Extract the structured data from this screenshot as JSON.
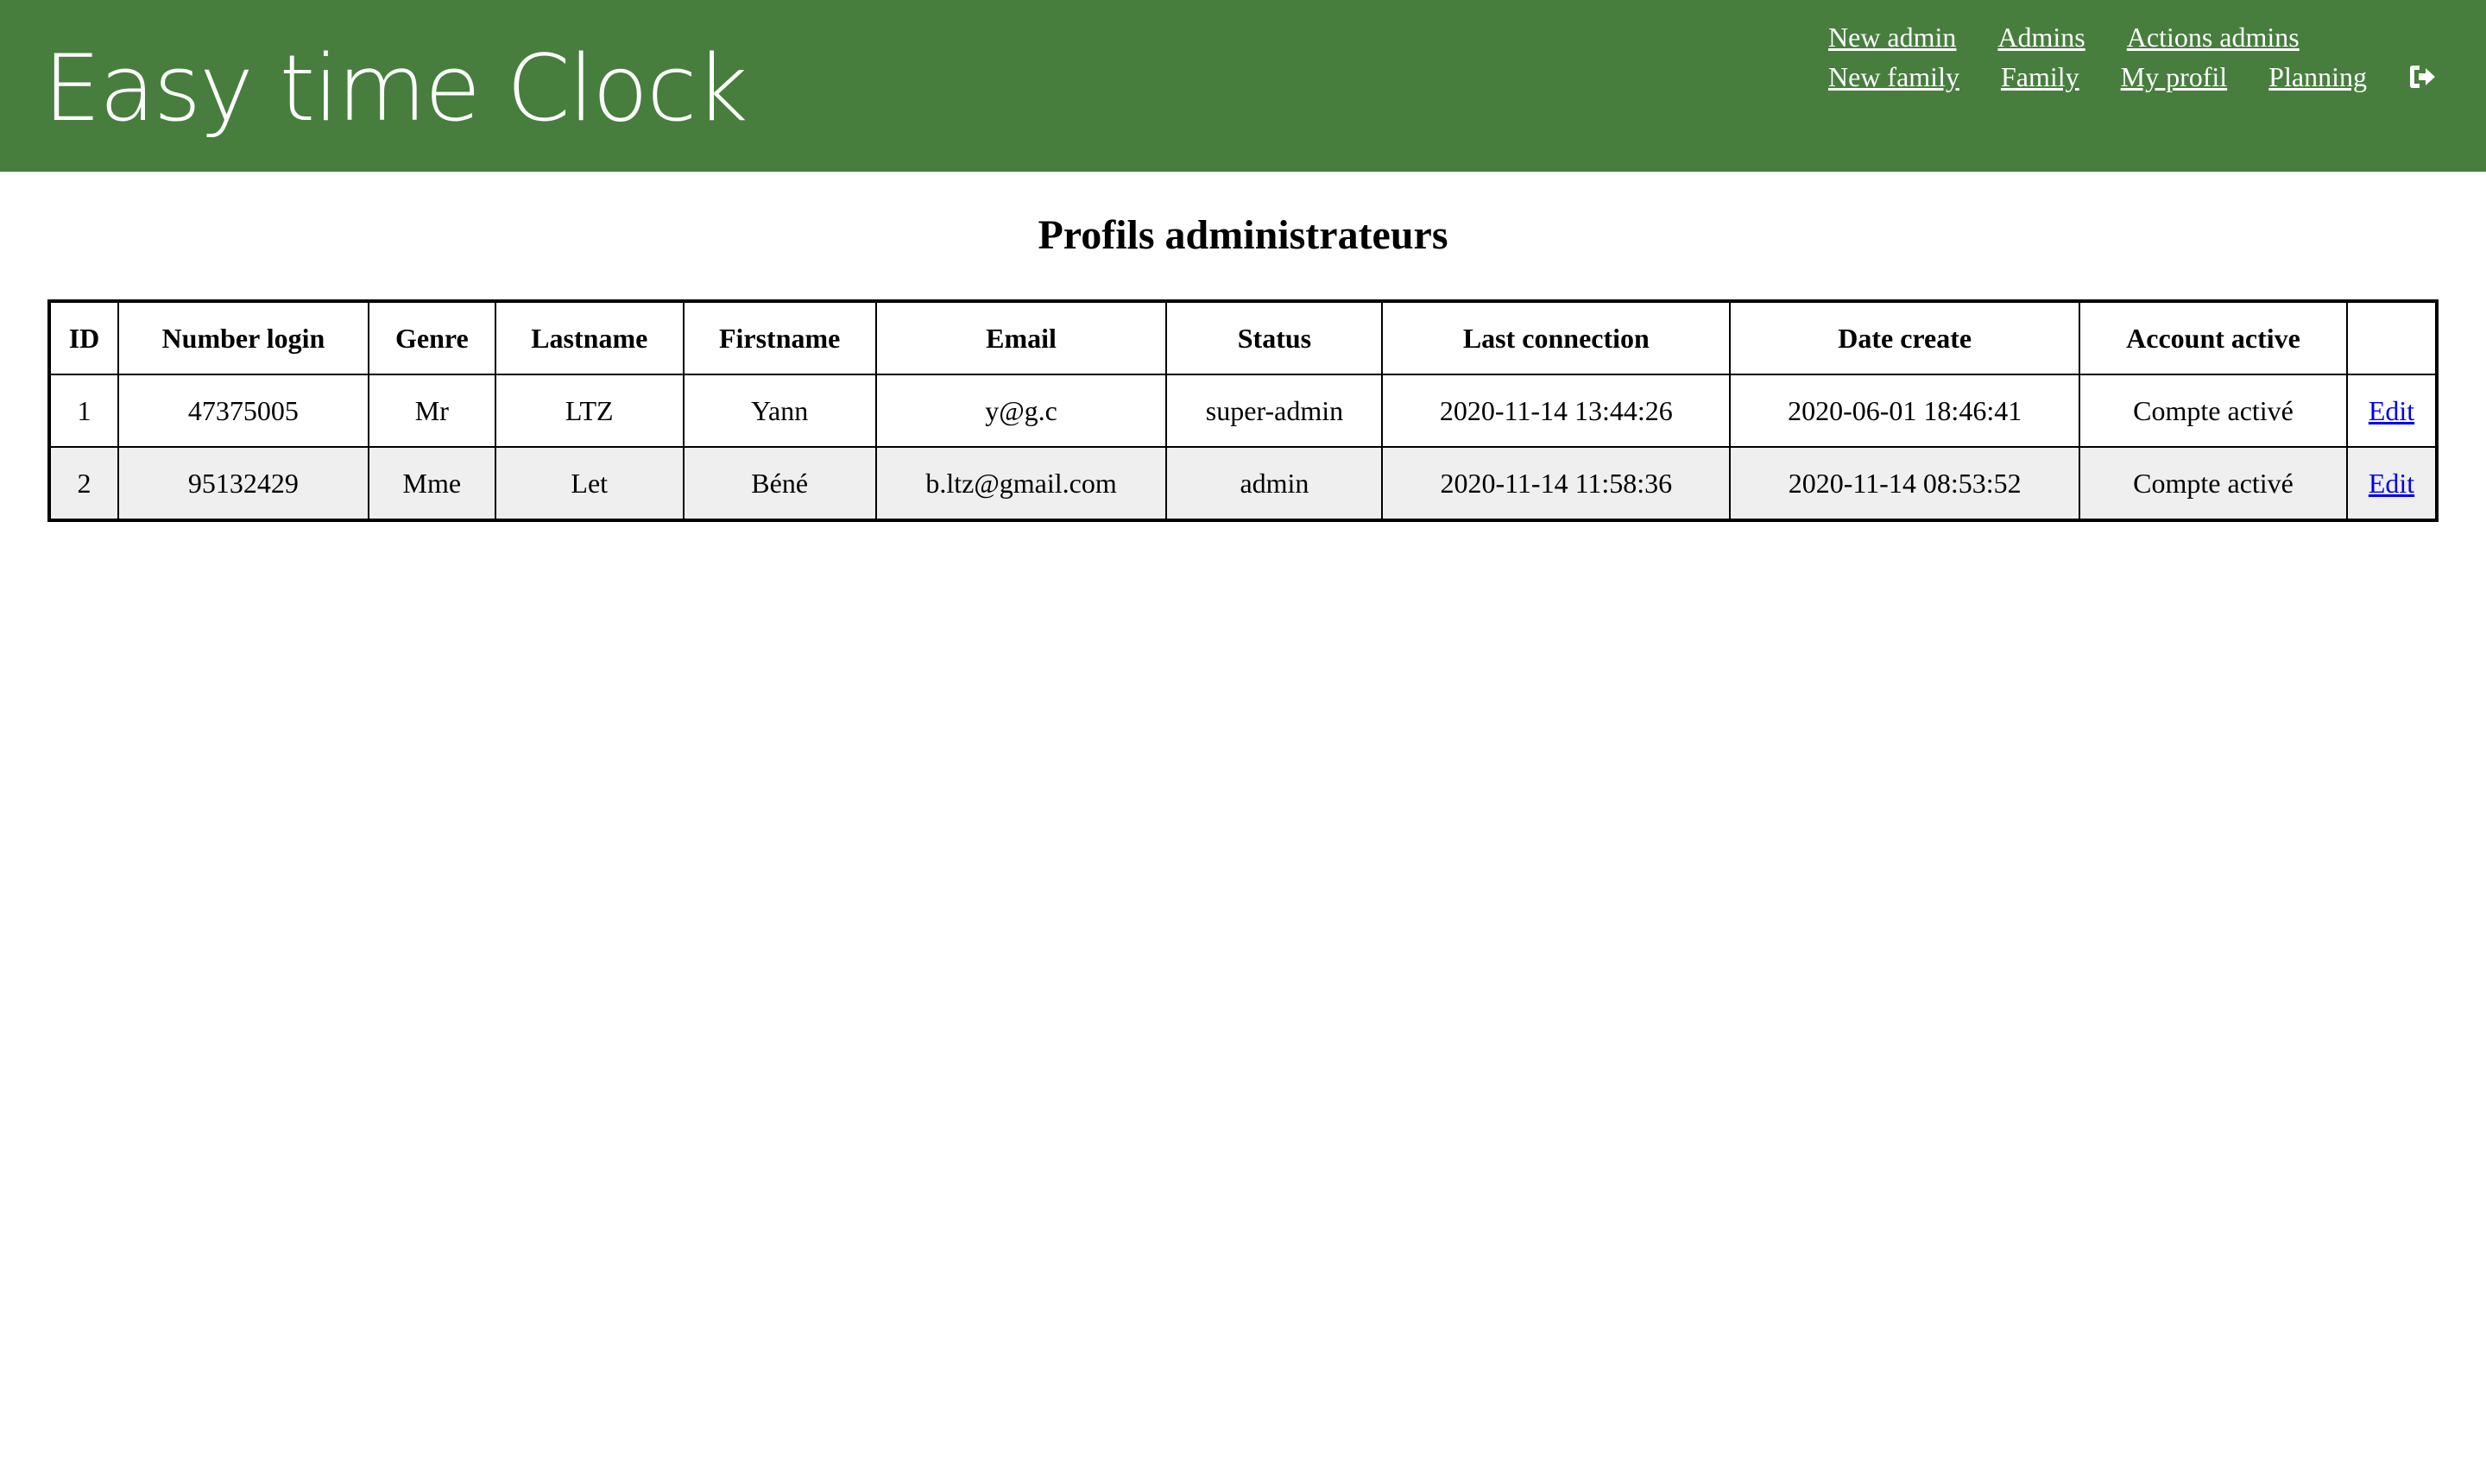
{
  "header": {
    "app_title": "Easy time Clock",
    "background_color": "#477e3e",
    "nav_row1": [
      "New admin",
      "Admins",
      "Actions admins"
    ],
    "nav_row2": [
      "New family",
      "Family",
      "My profil",
      "Planning"
    ],
    "logout_icon": "sign-out-icon"
  },
  "main": {
    "page_title": "Profils administrateurs",
    "table": {
      "columns": [
        "ID",
        "Number login",
        "Genre",
        "Lastname",
        "Firstname",
        "Email",
        "Status",
        "Last connection",
        "Date create",
        "Account active",
        ""
      ],
      "rows": [
        {
          "id": "1",
          "number_login": "47375005",
          "genre": "Mr",
          "lastname": "LTZ",
          "firstname": "Yann",
          "email": "y@g.c",
          "status": "super-admin",
          "last_connection": "2020-11-14 13:44:26",
          "date_create": "2020-06-01 18:46:41",
          "account_active": "Compte activé",
          "action": "Edit"
        },
        {
          "id": "2",
          "number_login": "95132429",
          "genre": "Mme",
          "lastname": "Let",
          "firstname": "Béné",
          "email": "b.ltz@gmail.com",
          "status": "admin",
          "last_connection": "2020-11-14 11:58:36",
          "date_create": "2020-11-14 08:53:52",
          "account_active": "Compte activé",
          "action": "Edit"
        }
      ]
    }
  }
}
